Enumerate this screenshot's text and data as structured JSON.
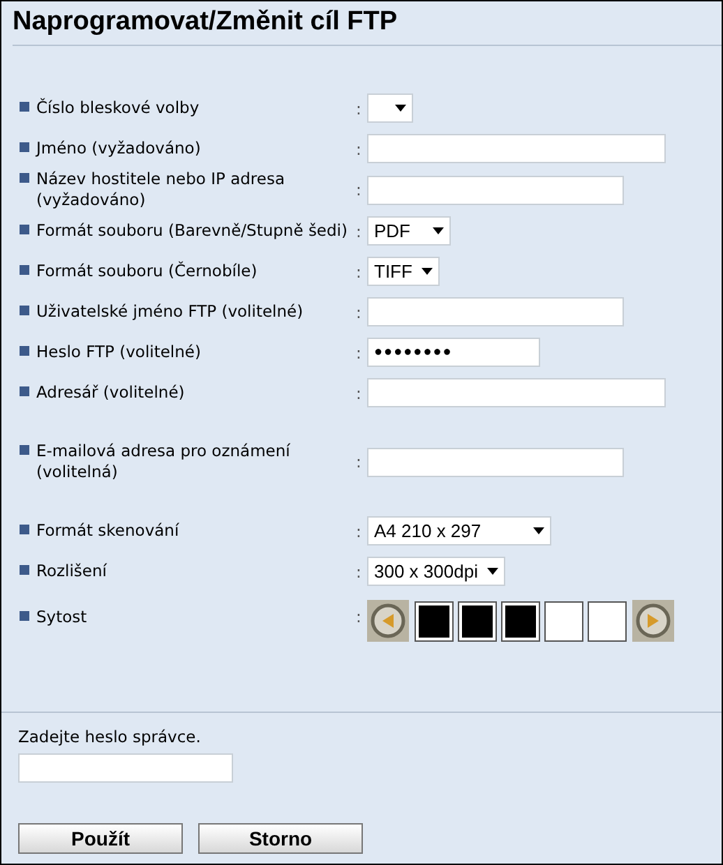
{
  "title": "Naprogramovat/Změnit cíl FTP",
  "sections": [
    {
      "rows": [
        {
          "label": "Číslo bleskové volby",
          "sep": ":",
          "kind": "select",
          "value": ""
        },
        {
          "label": "Jméno (vyžadováno)",
          "sep": ":",
          "kind": "text",
          "value": ""
        },
        {
          "label": "Název hostitele nebo IP adresa (vyžadováno)",
          "sep": ":",
          "kind": "text",
          "value": ""
        },
        {
          "label": "Formát souboru (Barevně/Stupně šedi)",
          "sep": ":",
          "kind": "select",
          "value": "PDF"
        },
        {
          "label": "Formát souboru (Černobíle)",
          "sep": ":",
          "kind": "select",
          "value": "TIFF"
        },
        {
          "label": "Uživatelské jméno FTP (volitelné)",
          "sep": ":",
          "kind": "text",
          "value": ""
        },
        {
          "label": "Heslo FTP (volitelné)",
          "sep": ":",
          "kind": "password",
          "value": "●●●●●●●●"
        },
        {
          "label": "Adresář (volitelné)",
          "sep": ":",
          "kind": "text",
          "value": ""
        }
      ]
    },
    {
      "rows": [
        {
          "label": "E-mailová adresa pro oznámení (volitelná)",
          "sep": ":",
          "kind": "text",
          "value": ""
        }
      ]
    },
    {
      "rows": [
        {
          "label": "Formát skenování",
          "sep": ":",
          "kind": "select",
          "value": "A4 210 x 297"
        },
        {
          "label": "Rozlišení",
          "sep": ":",
          "kind": "select",
          "value": "300 x 300dpi"
        },
        {
          "label": "Sytost",
          "sep": ":",
          "kind": "density",
          "cells": [
            {
              "filled": true
            },
            {
              "filled": true
            },
            {
              "filled": true
            },
            {
              "filled": false
            },
            {
              "filled": false
            }
          ]
        }
      ]
    }
  ],
  "admin": {
    "label": "Zadejte heslo správce."
  },
  "buttons": [
    "Použít",
    "Storno"
  ]
}
